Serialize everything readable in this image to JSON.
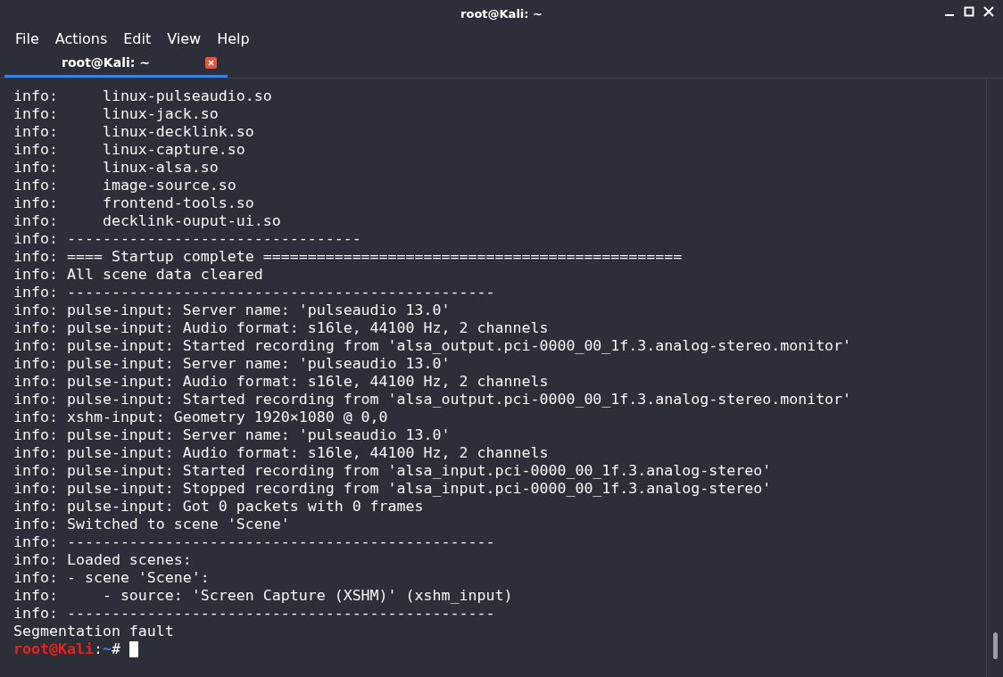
{
  "window": {
    "title": "root@Kali: ~"
  },
  "menu": [
    "File",
    "Actions",
    "Edit",
    "View",
    "Help"
  ],
  "tabs": [
    {
      "label": "root@Kali: ~",
      "selected": true
    }
  ],
  "output": [
    "info:     linux-pulseaudio.so",
    "info:     linux-jack.so",
    "info:     linux-decklink.so",
    "info:     linux-capture.so",
    "info:     linux-alsa.so",
    "info:     image-source.so",
    "info:     frontend-tools.so",
    "info:     decklink-ouput-ui.so",
    "info: ---------------------------------",
    "info: ==== Startup complete ===============================================",
    "info: All scene data cleared",
    "info: ------------------------------------------------",
    "info: pulse-input: Server name: 'pulseaudio 13.0'",
    "info: pulse-input: Audio format: s16le, 44100 Hz, 2 channels",
    "info: pulse-input: Started recording from 'alsa_output.pci-0000_00_1f.3.analog-stereo.monitor'",
    "info: pulse-input: Server name: 'pulseaudio 13.0'",
    "info: pulse-input: Audio format: s16le, 44100 Hz, 2 channels",
    "info: pulse-input: Started recording from 'alsa_output.pci-0000_00_1f.3.analog-stereo.monitor'",
    "info: xshm-input: Geometry 1920×1080 @ 0,0",
    "info: pulse-input: Server name: 'pulseaudio 13.0'",
    "info: pulse-input: Audio format: s16le, 44100 Hz, 2 channels",
    "info: pulse-input: Started recording from 'alsa_input.pci-0000_00_1f.3.analog-stereo'",
    "info: pulse-input: Stopped recording from 'alsa_input.pci-0000_00_1f.3.analog-stereo'",
    "info: pulse-input: Got 0 packets with 0 frames",
    "info: Switched to scene 'Scene'",
    "info: ------------------------------------------------",
    "info: Loaded scenes:",
    "info: - scene 'Scene':",
    "info:     - source: 'Screen Capture (XSHM)' (xshm_input)",
    "info: ------------------------------------------------",
    "Segmentation fault"
  ],
  "prompt": {
    "user_host": "root@Kali",
    "separator": ":",
    "path": "~",
    "symbol": "#"
  }
}
